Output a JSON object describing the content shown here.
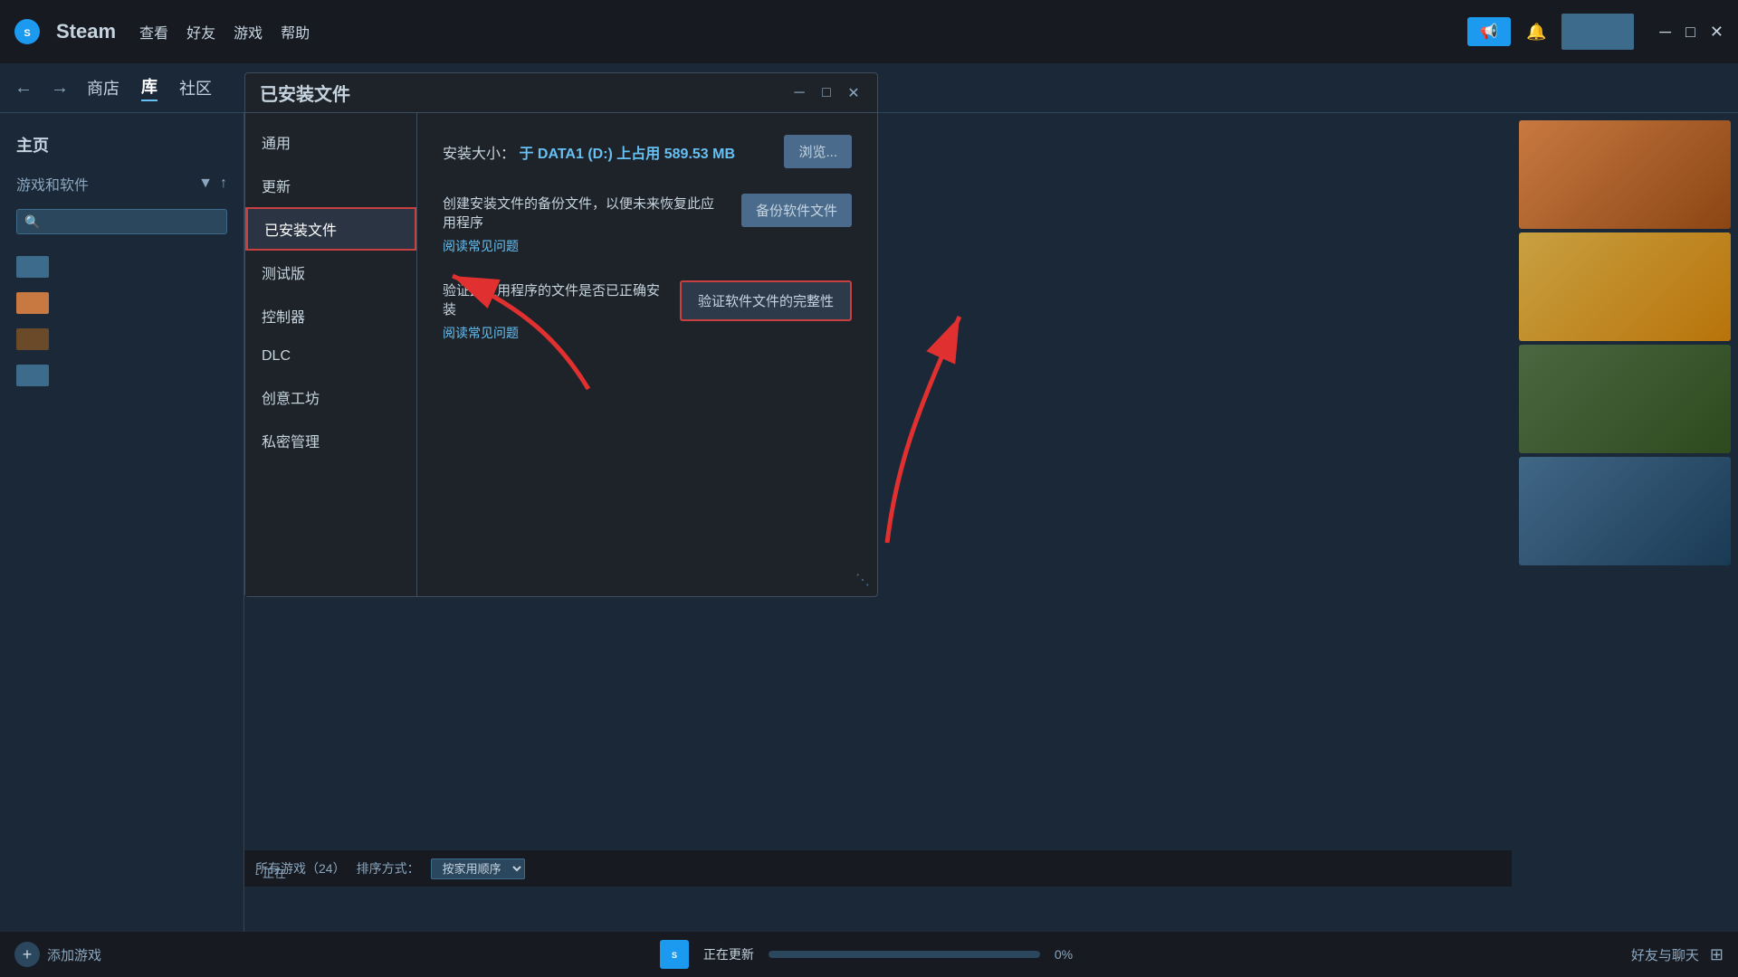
{
  "titlebar": {
    "steam_label": "Steam",
    "menu_items": [
      "查看",
      "好友",
      "游戏",
      "帮助"
    ],
    "broadcast_label": "📢",
    "minimize_label": "─",
    "maximize_label": "□",
    "close_label": "✕"
  },
  "navbar": {
    "back_arrow": "←",
    "forward_arrow": "→",
    "links": [
      {
        "label": "商店",
        "active": false
      },
      {
        "label": "库",
        "active": true
      },
      {
        "label": "社区",
        "active": false
      }
    ],
    "search_placeholder": ""
  },
  "sidebar": {
    "home_label": "主页",
    "filter_label": "游戏和软件",
    "filter_chevron": "▼",
    "filter_up": "↑",
    "search_placeholder": "🔍",
    "games": []
  },
  "dialog": {
    "title": "已安装文件",
    "win_controls": {
      "minimize": "─",
      "maximize": "□",
      "close": "✕"
    },
    "menu_items": [
      {
        "label": "通用",
        "active": false
      },
      {
        "label": "更新",
        "active": false
      },
      {
        "label": "已安装文件",
        "active": true
      },
      {
        "label": "测试版",
        "active": false
      },
      {
        "label": "控制器",
        "active": false
      },
      {
        "label": "DLC",
        "active": false
      },
      {
        "label": "创意工坊",
        "active": false
      },
      {
        "label": "私密管理",
        "active": false
      }
    ],
    "content": {
      "install_size_prefix": "安装大小：",
      "install_size_detail": "于 DATA1 (D:) 上占用 589.53 MB",
      "browse_btn": "浏览...",
      "backup_section": {
        "main_text": "创建安装文件的备份文件，以便未来恢复此应用程序",
        "link_text": "阅读常见问题",
        "btn_label": "备份软件文件"
      },
      "verify_section": {
        "main_text": "验证此应用程序的文件是否已正确安装",
        "link_text": "阅读常见问题",
        "btn_label": "验证软件文件的完整性"
      }
    }
  },
  "statusbar": {
    "add_game_label": "添加游戏",
    "updating_label": "正在更新",
    "progress_percent": "0%",
    "friends_label": "好友与聊天"
  },
  "bottom_bar": {
    "all_games_label": "所有游戏（24）",
    "sort_prefix": "排序方式：",
    "sort_value": "按家用顺序",
    "updating_prefix": "- 正在"
  }
}
